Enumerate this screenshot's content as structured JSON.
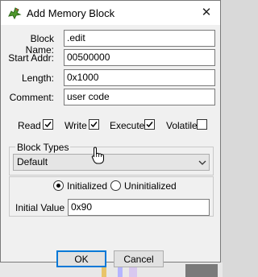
{
  "window": {
    "title": "Add Memory Block",
    "close_glyph": "✕"
  },
  "fields": [
    {
      "label": "Block Name:",
      "value": ".edit"
    },
    {
      "label": "Start Addr:",
      "value": "00500000"
    },
    {
      "label": "Length:",
      "value": "0x1000"
    },
    {
      "label": "Comment:",
      "value": "user code"
    }
  ],
  "permissions": [
    {
      "label": "Read",
      "checked": true
    },
    {
      "label": "Write",
      "checked": true
    },
    {
      "label": "Execute",
      "checked": true
    },
    {
      "label": "Volatile",
      "checked": false
    }
  ],
  "block_types": {
    "group_title": "Block Types",
    "selected": "Default"
  },
  "init": {
    "initialized_label": "Initialized",
    "uninitialized_label": "Uninitialized",
    "selected": "initialized",
    "initial_value_label": "Initial Value",
    "initial_value": "0x90"
  },
  "buttons": {
    "ok": "OK",
    "cancel": "Cancel"
  },
  "icons": {
    "app": "dragon-icon",
    "cursor": "hand-pointer-icon"
  },
  "colors": {
    "accent": "#0078d7"
  }
}
